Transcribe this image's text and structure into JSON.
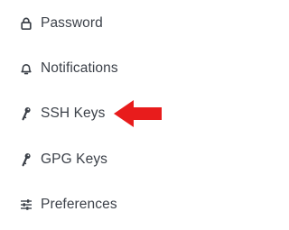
{
  "menu": {
    "items": [
      {
        "label": "Password",
        "icon": "lock-icon"
      },
      {
        "label": "Notifications",
        "icon": "bell-icon"
      },
      {
        "label": "SSH Keys",
        "icon": "key-icon"
      },
      {
        "label": "GPG Keys",
        "icon": "key-icon"
      },
      {
        "label": "Preferences",
        "icon": "sliders-icon"
      }
    ]
  },
  "colors": {
    "text": "#3c4149",
    "icon": "#3c4149",
    "arrow": "#e81c1c"
  }
}
